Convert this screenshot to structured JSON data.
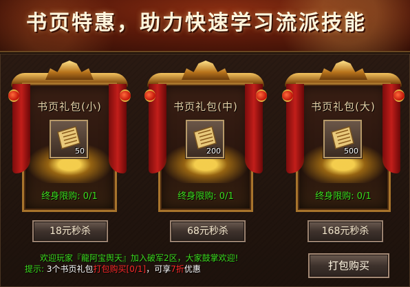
{
  "banner": {
    "title": "书页特惠，助力快速学习流派技能"
  },
  "packs": [
    {
      "name": "书页礼包(小)",
      "count": "50",
      "limit": "终身限购: 0/1",
      "button": "18元秒杀"
    },
    {
      "name": "书页礼包(中)",
      "count": "200",
      "limit": "终身限购: 0/1",
      "button": "68元秒杀"
    },
    {
      "name": "书页礼包(大)",
      "count": "500",
      "limit": "终身限购: 0/1",
      "button": "168元秒杀"
    }
  ],
  "footer": {
    "welcome": "欢迎玩家『龍阿宝舆天』加入破军2区，大家鼓掌欢迎!",
    "tip_label": "提示:",
    "tip_part1": "3个书页礼包",
    "tip_link": "打包购买[0/1]",
    "tip_part2": "，可享",
    "tip_discount": "7折",
    "tip_part3": "优惠",
    "bundle_button": "打包购买"
  },
  "colors": {
    "limit_green": "#3cdc1e",
    "highlight_red": "#ff2a2a",
    "frame_gold": "#a8742c"
  },
  "icons": [
    "scroll-icon",
    "lantern-icon",
    "crown-ornament-icon"
  ]
}
